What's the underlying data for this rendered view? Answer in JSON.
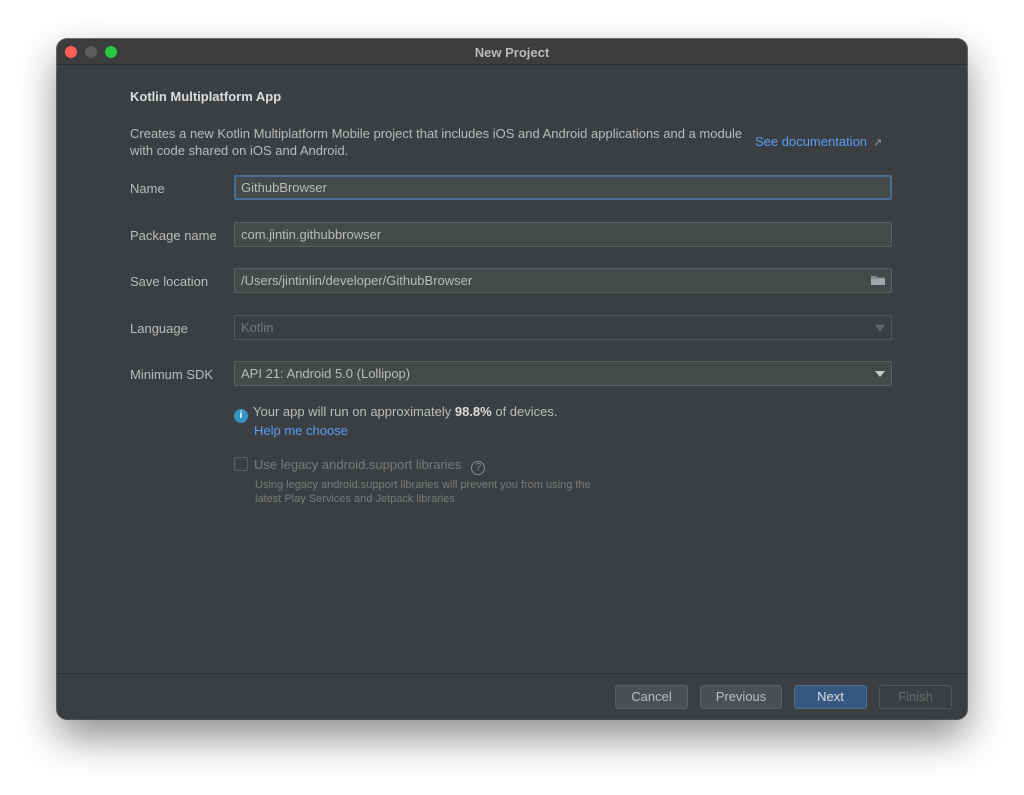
{
  "window": {
    "title": "New Project"
  },
  "header": {
    "title": "Kotlin Multiplatform App",
    "description": "Creates a new Kotlin Multiplatform Mobile project that includes iOS and Android applications and a module with code shared on iOS and Android.",
    "doc_link": "See documentation",
    "doc_link_arrow": "↗"
  },
  "form": {
    "name": {
      "label": "Name",
      "value": "GithubBrowser"
    },
    "package": {
      "label": "Package name",
      "value": "com.jintin.githubbrowser"
    },
    "location": {
      "label": "Save location",
      "value": "/Users/jintinlin/developer/GithubBrowser"
    },
    "language": {
      "label": "Language",
      "value": "Kotlin"
    },
    "min_sdk": {
      "label": "Minimum SDK",
      "value": "API 21: Android 5.0 (Lollipop)"
    }
  },
  "info": {
    "icon": "i",
    "prefix": "Your app will run on approximately ",
    "percent": "98.8%",
    "suffix": " of devices.",
    "help_link": "Help me choose"
  },
  "legacy": {
    "label": "Use legacy android.support libraries",
    "help_icon": "?",
    "description": "Using legacy android.support libraries will prevent you from using the latest Play Services and Jetpack libraries"
  },
  "footer": {
    "cancel": "Cancel",
    "previous": "Previous",
    "next": "Next",
    "finish": "Finish"
  },
  "colors": {
    "window_bg": "#3c3f41",
    "link": "#589df6",
    "primary_button": "#365880",
    "focus_border": "#466d94",
    "info_icon": "#3592c4"
  }
}
